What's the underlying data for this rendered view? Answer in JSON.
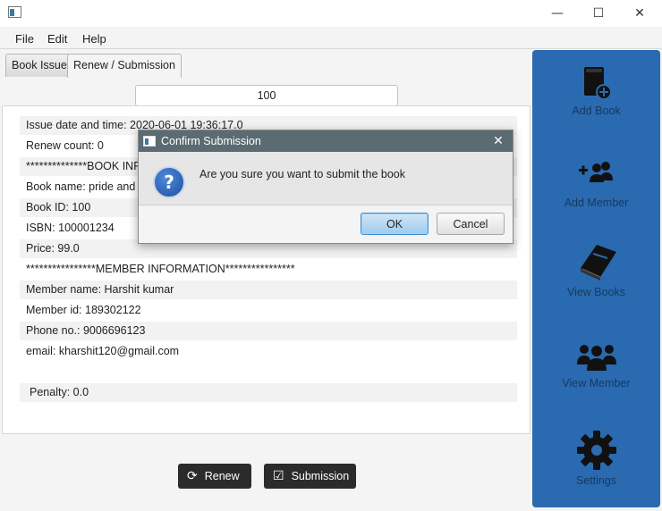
{
  "window": {
    "minimize": "—",
    "maximize": "☐",
    "close": "✕"
  },
  "menu": [
    "File",
    "Edit",
    "Help"
  ],
  "tabs": [
    "Book Issue",
    "Renew / Submission"
  ],
  "search": {
    "value": "100"
  },
  "info_rows": [
    "Issue date and time: 2020-06-01 19:36:17.0",
    "Renew count: 0",
    "**************BOOK INFORMATION**************",
    "Book name: pride and prejudice",
    "Book ID: 100",
    "ISBN: 100001234",
    "Price: 99.0",
    "****************MEMBER INFORMATION****************",
    "Member name: Harshit kumar",
    "Member id: 189302122",
    "Phone no.:  9006696123",
    "email: kharshit120@gmail.com"
  ],
  "penalty": "Penalty: 0.0",
  "actions": {
    "renew": "Renew",
    "submission": "Submission"
  },
  "sidebar": [
    {
      "label": "Add Book",
      "icon": "add-book-icon"
    },
    {
      "label": "Add Member",
      "icon": "add-member-icon"
    },
    {
      "label": "View Books",
      "icon": "book-icon"
    },
    {
      "label": "View Member",
      "icon": "users-icon"
    },
    {
      "label": "Settings",
      "icon": "gear-icon"
    }
  ],
  "dialog": {
    "title": "Confirm Submission",
    "message": "Are you sure you want to submit the book",
    "ok": "OK",
    "cancel": "Cancel"
  },
  "colors": {
    "sidebar": "#2a6ab0",
    "dialog_title": "#5b6b72",
    "button_dark": "#2b2b2b"
  }
}
